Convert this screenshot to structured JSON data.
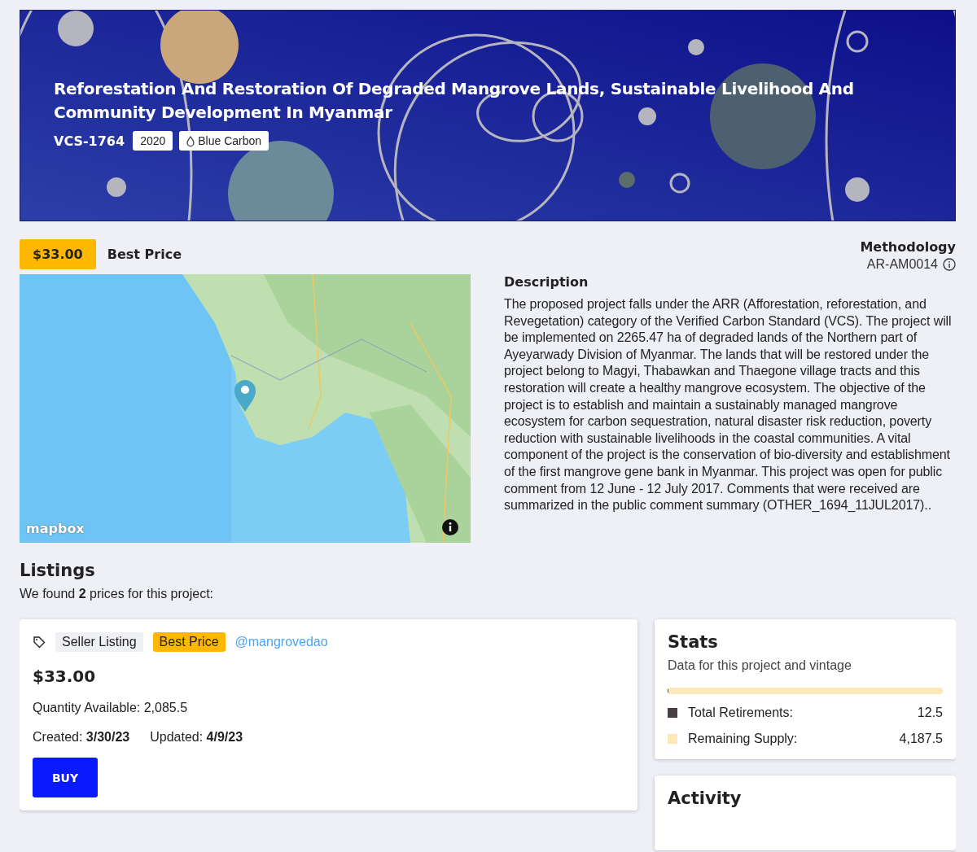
{
  "banner": {
    "title": "Reforestation And Restoration Of Degraded Mangrove Lands, Sustainable Livelihood And Community Development In Myanmar",
    "project_id": "VCS-1764",
    "tags": [
      {
        "kind": "plain",
        "label": "2020"
      },
      {
        "kind": "category",
        "label": "Blue Carbon"
      }
    ]
  },
  "price_bar": {
    "price": "$33.00",
    "label": "Best Price",
    "methodology": {
      "heading": "Methodology",
      "value": "AR-AM0014"
    }
  },
  "map": {
    "kind": "picture",
    "attribution": "mapbox"
  },
  "description": {
    "heading": "Description",
    "text": "The proposed project falls under the ARR (Afforestation, reforestation, and Revegetation) category of the Verified Carbon Standard (VCS). The project will be implemented on 2265.47 ha of degraded lands of the Northern part of Ayeyarwady Division of Myanmar. The lands that will be restored under the project belong to Magyi, Thabawkan and Thaegone village tracts and this restoration will create a healthy mangrove ecosystem. The objective of the project is to establish and maintain a sustainably managed mangrove ecosystem for carbon sequestration, natural disaster risk reduction, poverty reduction with sustainable livelihoods in the coastal communities. A vital component of the project is the conservation of bio-diversity and establishment of the first mangrove gene bank in Myanmar. This project was open for public comment from 12 June - 12 July 2017. Comments that were received are summarized in the public comment summary (OTHER_1694_11JUL2017).."
  },
  "listings": {
    "heading": "Listings",
    "summary": "We found **2** prices for this project:"
  },
  "listing_card": {
    "badges": [
      {
        "kind": "neutral",
        "label": "Seller Listing"
      },
      {
        "kind": "highlight",
        "label": "Best Price"
      }
    ],
    "seller": "@mangrovedao",
    "price": "$33.00",
    "quantity": "Quantity Available: 2,085.5",
    "created_label": "Created:",
    "created": "3/30/23",
    "updated_label": "Updated:",
    "updated": "4/9/23",
    "button": "BUY"
  },
  "stats": {
    "heading": "Stats",
    "subtitle": "Data for this project and vintage",
    "level": 0.003,
    "legend": [
      {
        "label": "Total Retirements:",
        "value": "12.5",
        "color": "#4a3f45"
      },
      {
        "label": "Remaining Supply:",
        "value": "4,187.5",
        "color": "#fde9b8"
      }
    ]
  },
  "activity": {
    "heading": "Activity"
  }
}
